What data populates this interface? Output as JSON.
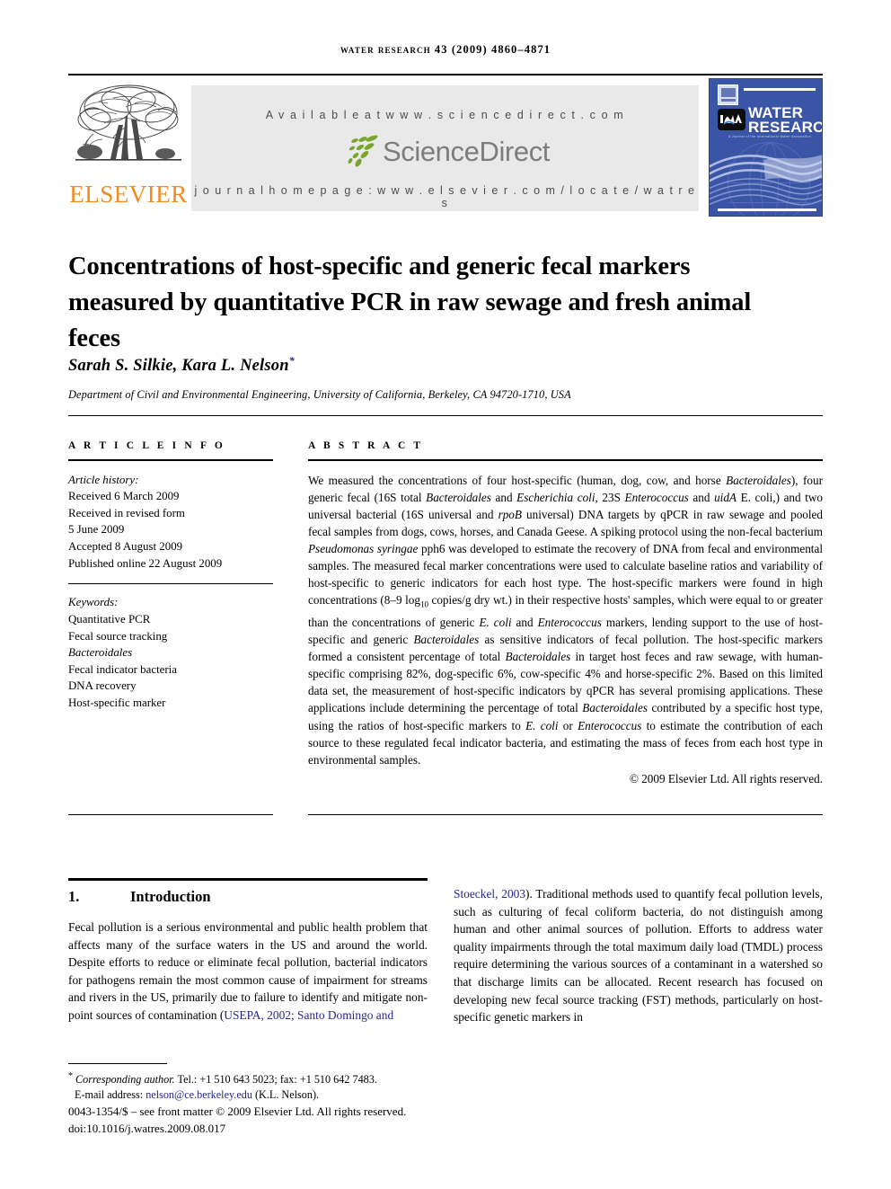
{
  "running_head": "Water Research 43 (2009) 4860–4871",
  "masthead": {
    "publisher_name": "ELSEVIER",
    "publisher_logo_alt": "elsevier-tree-logo",
    "available_at": "A v a i l a b l e   a t   w w w . s c i e n c e d i r e c t . c o m",
    "sciencedirect_word": "ScienceDirect",
    "journal_homepage": "j o u r n a l   h o m e p a g e :   w w w . e l s e v i e r . c o m / l o c a t e / w a t r e s",
    "cover": {
      "title_line1": "WATER",
      "title_line2": "RESEARCH",
      "association_mark": "IWA",
      "tagline": "A Journal of the International Water Association"
    }
  },
  "article": {
    "title": "Concentrations of host-specific and generic fecal markers measured by quantitative PCR in raw sewage and fresh animal feces",
    "authors": "Sarah S. Silkie, Kara L. Nelson",
    "corresponding_marker": "*",
    "affiliation": "Department of Civil and Environmental Engineering, University of California, Berkeley, CA 94720-1710, USA"
  },
  "article_info": {
    "label": "A R T I C L E   I N F O",
    "history_heading": "Article history:",
    "history": [
      "Received 6 March 2009",
      "Received in revised form",
      "5 June 2009",
      "Accepted 8 August 2009",
      "Published online 22 August 2009"
    ],
    "keywords_heading": "Keywords:",
    "keywords": [
      "Quantitative PCR",
      "Fecal source tracking",
      "Bacteroidales",
      "Fecal indicator bacteria",
      "DNA recovery",
      "Host-specific marker"
    ]
  },
  "abstract": {
    "label": "A B S T R A C T",
    "copyright": "© 2009 Elsevier Ltd. All rights reserved.",
    "paragraph_parts": [
      {
        "t": "We measured the concentrations of four host-specific (human, dog, cow, and horse "
      },
      {
        "t": "Bacteroidales",
        "i": true
      },
      {
        "t": "), four generic fecal (16S total "
      },
      {
        "t": "Bacteroidales",
        "i": true
      },
      {
        "t": " and "
      },
      {
        "t": "Escherichia coli",
        "i": true
      },
      {
        "t": ", 23S "
      },
      {
        "t": "Enterococcus",
        "i": true
      },
      {
        "t": " and "
      },
      {
        "t": "uidA",
        "i": true
      },
      {
        "t": " E. coli,) and two universal bacterial (16S universal and "
      },
      {
        "t": "rpoB",
        "i": true
      },
      {
        "t": " universal) DNA targets by qPCR in raw sewage and pooled fecal samples from dogs, cows, horses, and Canada Geese. A spiking protocol using the non-fecal bacterium "
      },
      {
        "t": "Pseudomonas syringae",
        "i": true
      },
      {
        "t": " pph6 was developed to estimate the recovery of DNA from fecal and environmental samples. The measured fecal marker concentrations were used to calculate baseline ratios and variability of host-specific to generic indicators for each host type. The host-specific markers were found in high concentrations (8–9 log"
      },
      {
        "t": "10",
        "sub": true
      },
      {
        "t": " copies/g dry wt.) in their respective hosts' samples, which were equal to or greater than the concentrations of generic "
      },
      {
        "t": "E. coli",
        "i": true
      },
      {
        "t": " and "
      },
      {
        "t": "Enterococcus",
        "i": true
      },
      {
        "t": " markers, lending support to the use of host-specific and generic "
      },
      {
        "t": "Bacteroidales",
        "i": true
      },
      {
        "t": " as sensitive indicators of fecal pollution. The host-specific markers formed a consistent percentage of total "
      },
      {
        "t": "Bacteroidales",
        "i": true
      },
      {
        "t": " in target host feces and raw sewage, with human-specific comprising 82%, dog-specific 6%, cow-specific 4% and horse-specific 2%. Based on this limited data set, the measurement of host-specific indicators by qPCR has several promising applications. These applications include determining the percentage of total "
      },
      {
        "t": "Bacteroidales",
        "i": true
      },
      {
        "t": " contributed by a specific host type, using the ratios of host-specific markers to "
      },
      {
        "t": "E. coli",
        "i": true
      },
      {
        "t": " or "
      },
      {
        "t": "Enterococcus",
        "i": true
      },
      {
        "t": " to estimate the contribution of each source to these regulated fecal indicator bacteria, and estimating the mass of feces from each host type in environmental samples."
      }
    ]
  },
  "introduction": {
    "number": "1.",
    "heading": "Introduction",
    "left_column_parts": [
      {
        "t": "Fecal pollution is a serious environmental and public health problem that affects many of the surface waters in the US and around the world. Despite efforts to reduce or eliminate fecal pollution, bacterial indicators for pathogens remain the most common cause of impairment for streams and rivers in the US, primarily due to failure to identify and mitigate non-point sources of contamination ("
      },
      {
        "t": "USEPA, 2002; Santo Domingo and",
        "cite": true
      }
    ],
    "right_column_parts": [
      {
        "t": "Stoeckel, 2003",
        "cite": true
      },
      {
        "t": "). Traditional methods used to quantify fecal pollution levels, such as culturing of fecal coliform bacteria, do not distinguish among human and other animal sources of pollution. Efforts to address water quality impairments through the total maximum daily load (TMDL) process require determining the various sources of a contaminant in a watershed so that discharge limits can be allocated. Recent research has focused on developing new fecal source tracking (FST) methods, particularly on host-specific genetic markers in"
      }
    ]
  },
  "footer": {
    "corresponding_star": "*",
    "corresponding_line": "Corresponding author.",
    "corresponding_contact": " Tel.: +1 510 643 5023; fax: +1 510 642 7483.",
    "email_label": "E-mail address:",
    "email": "nelson@ce.berkeley.edu",
    "email_owner": "(K.L. Nelson).",
    "frontmatter": "0043-1354/$ – see front matter © 2009 Elsevier Ltd. All rights reserved.",
    "doi": "doi:10.1016/j.watres.2009.08.017"
  },
  "colors": {
    "elsevier_orange": "#F08C1E",
    "cover_blue": "#3A55A5",
    "sciencedirect_green": "#7AA52D",
    "sciencedirect_gray": "#7D7D7D",
    "link_blue": "#26268C",
    "banner_gray": "#E9E9E9"
  }
}
